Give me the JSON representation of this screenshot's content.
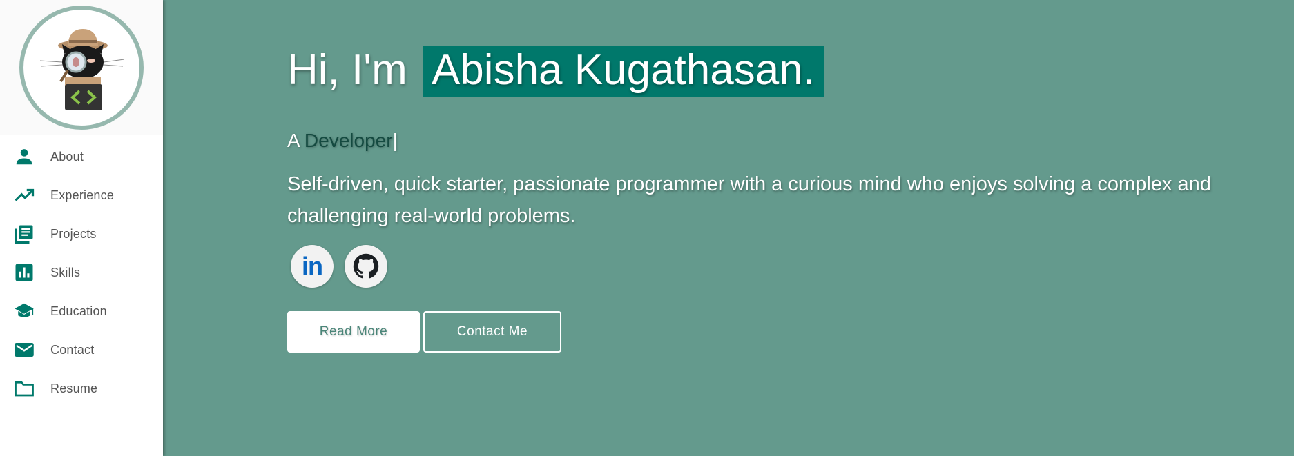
{
  "sidebar": {
    "items": [
      {
        "label": "About",
        "icon": "person-icon"
      },
      {
        "label": "Experience",
        "icon": "trending-up-icon"
      },
      {
        "label": "Projects",
        "icon": "library-books-icon"
      },
      {
        "label": "Skills",
        "icon": "bar-chart-icon"
      },
      {
        "label": "Education",
        "icon": "graduation-cap-icon"
      },
      {
        "label": "Contact",
        "icon": "mail-icon"
      },
      {
        "label": "Resume",
        "icon": "folder-icon"
      }
    ]
  },
  "hero": {
    "greeting": "Hi, I'm",
    "name": "Abisha Kugathasan.",
    "subtitle_prefix": "A",
    "role": "Developer",
    "cursor": "|",
    "tagline": "Self-driven, quick starter, passionate programmer with a curious mind who enjoys solving a complex and challenging real-world problems.",
    "social": [
      {
        "label": "in",
        "icon": "linkedin-icon"
      },
      {
        "icon": "github-icon"
      }
    ],
    "read_more": "Read More",
    "contact_me": "Contact Me"
  },
  "colors": {
    "background": "#649a8d",
    "accent": "#00786b",
    "icon": "#00796b",
    "avatar_ring": "#96b8ae"
  }
}
